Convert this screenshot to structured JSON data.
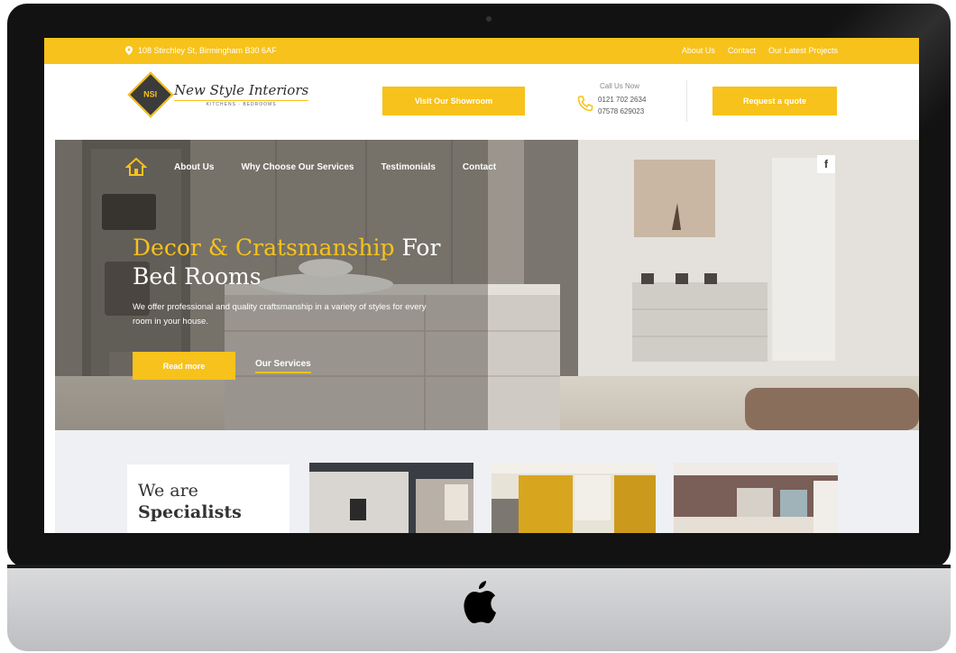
{
  "topbar": {
    "address": "108 Stirchley St, Birmingham B30 6AF",
    "links": [
      "About Us",
      "Contact",
      "Our Latest Projects"
    ]
  },
  "header": {
    "logo_initials": "NSI",
    "logo_name": "New Style Interiors",
    "logo_tagline": "KITCHENS · BEDROOMS",
    "showroom_button": "Visit Our Showroom",
    "call_title": "Call Us Now",
    "phone_1": "0121 702 2634",
    "phone_2": "07578 629023",
    "quote_button": "Request a quote"
  },
  "nav": {
    "items": [
      "About Us",
      "Why Choose Our Services",
      "Testimonials",
      "Contact"
    ],
    "facebook": "f"
  },
  "hero": {
    "title_accent": "Decor & Cratsmanship",
    "title_rest_1": " For",
    "title_line_2": "Bed Rooms",
    "subtitle": "We offer professional and quality craftsmanship in a variety of styles for every room in your house.",
    "read_more": "Read more",
    "our_services": "Our Services"
  },
  "specialists": {
    "line1": "We are",
    "line2": "Specialists"
  },
  "colors": {
    "accent": "#f7c21b",
    "dark": "#333333"
  }
}
